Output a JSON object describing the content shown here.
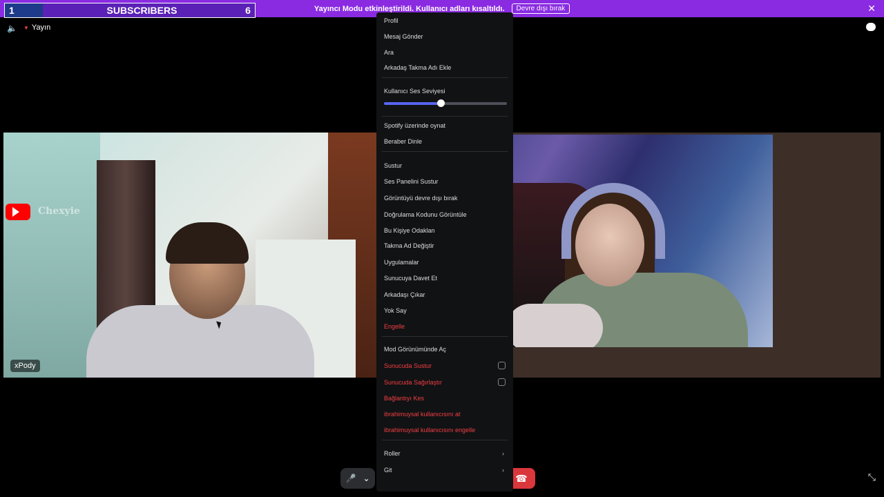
{
  "banner": {
    "text": "Yayıncı Modu etkinleştirildi. Kullanıcı adları kısaltıldı.",
    "button": "Devre dışı bırak",
    "close": "✕"
  },
  "subscribers": {
    "left_count": "1",
    "label": "SUBSCRIBERS",
    "right_count": "6"
  },
  "topbar": {
    "speaker": "🔈",
    "channel": "Yayın"
  },
  "tiles": {
    "left": {
      "overlay_name": "Chexyie",
      "label": "xPody"
    }
  },
  "menu": {
    "items": [
      {
        "label": "Profil",
        "style": "normal"
      },
      {
        "label": "Mesaj Gönder",
        "style": "normal"
      },
      {
        "label": "Ara",
        "style": "normal"
      },
      {
        "label": "Arkadaş Takma Adı Ekle",
        "style": "normal"
      },
      {
        "label": "Kullanıcı Ses Seviyesi",
        "style": "normal"
      },
      {
        "label": "Spotify üzerinde oynat",
        "style": "normal"
      },
      {
        "label": "Beraber Dinle",
        "style": "normal"
      },
      {
        "label": "Sustur",
        "style": "normal"
      },
      {
        "label": "Ses Panelini Sustur",
        "style": "normal"
      },
      {
        "label": "Görüntüyü devre dışı bırak",
        "style": "normal"
      },
      {
        "label": "Doğrulama Kodunu Görüntüle",
        "style": "normal"
      },
      {
        "label": "Bu Kişiye Odaklan",
        "style": "normal"
      },
      {
        "label": "Takma Ad Değiştir",
        "style": "normal"
      },
      {
        "label": "Uygulamalar",
        "style": "normal"
      },
      {
        "label": "Sunucuya Davet Et",
        "style": "normal"
      },
      {
        "label": "Arkadaşı Çıkar",
        "style": "normal"
      },
      {
        "label": "Yok Say",
        "style": "normal"
      },
      {
        "label": "Engelle",
        "style": "red"
      },
      {
        "label": "Mod Görünümünde Aç",
        "style": "normal"
      },
      {
        "label": "Sunucuda Sustur",
        "style": "red"
      },
      {
        "label": "Sunucuda Sağırlaştır",
        "style": "red"
      },
      {
        "label": "Bağlantıyı Kes",
        "style": "red"
      },
      {
        "label": "ibrahimuysal kullanıcısını at",
        "style": "red"
      },
      {
        "label": "ibrahimuysal kullanıcısını engelle",
        "style": "red"
      },
      {
        "label": "Roller",
        "style": "normal"
      },
      {
        "label": "Git",
        "style": "normal"
      }
    ],
    "volume_level": 0.46,
    "chevron": "›"
  },
  "controls": {
    "mic": "🎤",
    "mic_caret": "⌄",
    "hangup": "☎",
    "fullscreen": "⤡"
  },
  "colors": {
    "banner": "#8a2be2",
    "danger": "#f23f43",
    "slider_fill": "#5865f2"
  }
}
